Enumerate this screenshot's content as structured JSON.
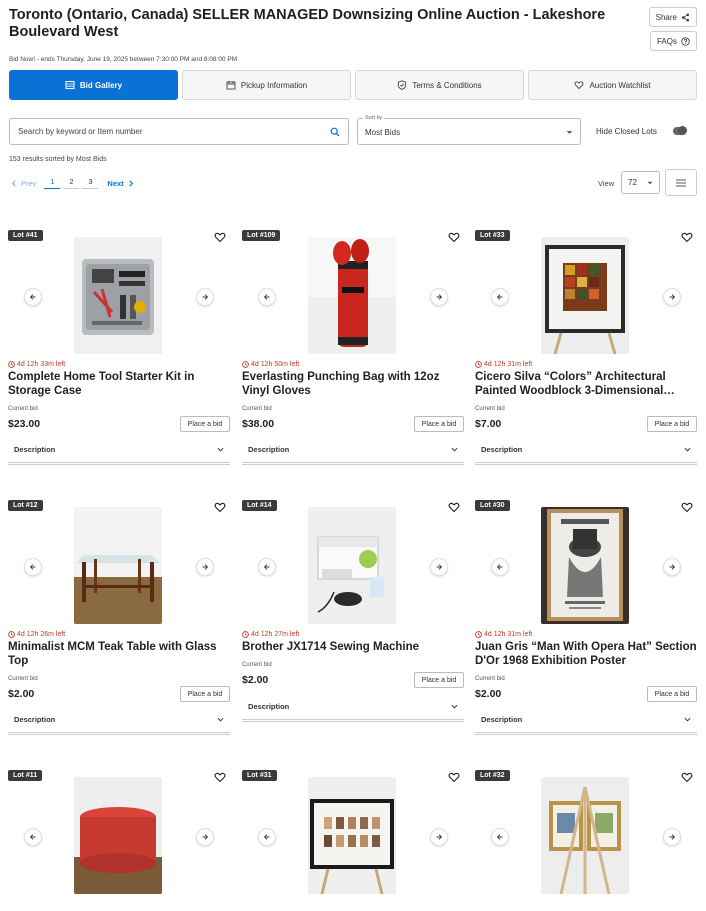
{
  "header": {
    "title": "Toronto (Ontario, Canada) SELLER MANAGED Downsizing Online Auction - Lakeshore Boulevard West",
    "share_label": "Share",
    "faqs_label": "FAQs",
    "subinfo": "Bid Now! - ends Thursday, June 19, 2025 between 7:30:00 PM and 8:08:00 PM"
  },
  "tabs": [
    {
      "label": "Bid Gallery",
      "icon": "gallery-icon",
      "active": true
    },
    {
      "label": "Pickup Information",
      "icon": "calendar-icon",
      "active": false
    },
    {
      "label": "Terms & Conditions",
      "icon": "shield-icon",
      "active": false
    },
    {
      "label": "Auction Watchlist",
      "icon": "heart-icon",
      "active": false
    }
  ],
  "search": {
    "placeholder": "Search by keyword or Item number"
  },
  "sort": {
    "label": "Sort by",
    "value": "Most Bids"
  },
  "hide_closed_label": "Hide Closed Lots",
  "results_text": "153 results sorted by Most Bids",
  "pagination": {
    "prev": "Prev",
    "pages": [
      "1",
      "2",
      "3"
    ],
    "current": "1",
    "next": "Next"
  },
  "view": {
    "label": "View",
    "value": "72"
  },
  "lots": [
    {
      "lot": "Lot #41",
      "time_left": "4d 12h 33m left",
      "title": "Complete Home Tool Starter Kit in Storage Case",
      "current_bid_label": "Current bid",
      "price": "$23.00",
      "bid_label": "Place a bid",
      "description_label": "Description"
    },
    {
      "lot": "Lot #109",
      "time_left": "4d 12h 50m left",
      "title": "Everlasting Punching Bag with 12oz Vinyl Gloves",
      "current_bid_label": "Current bid",
      "price": "$38.00",
      "bid_label": "Place a bid",
      "description_label": "Description"
    },
    {
      "lot": "Lot #33",
      "time_left": "4d 12h 31m left",
      "title": "Cicero Silva “Colors” Architectural Painted Woodblock 3-Dimensional…",
      "current_bid_label": "Current bid",
      "price": "$7.00",
      "bid_label": "Place a bid",
      "description_label": "Description"
    },
    {
      "lot": "Lot #12",
      "time_left": "4d 12h 26m left",
      "title": "Minimalist MCM Teak Table with Glass Top",
      "current_bid_label": "Current bid",
      "price": "$2.00",
      "bid_label": "Place a bid",
      "description_label": "Description"
    },
    {
      "lot": "Lot #14",
      "time_left": "4d 12h 27m left",
      "title": "Brother JX1714 Sewing Machine",
      "current_bid_label": "Current bid",
      "price": "$2.00",
      "bid_label": "Place a bid",
      "description_label": "Description"
    },
    {
      "lot": "Lot #30",
      "time_left": "4d 12h 31m left",
      "title": "Juan Gris “Man With Opera Hat” Section D'Or 1968 Exhibition Poster",
      "current_bid_label": "Current bid",
      "price": "$2.00",
      "bid_label": "Place a bid",
      "description_label": "Description"
    },
    {
      "lot": "Lot #11"
    },
    {
      "lot": "Lot #31"
    },
    {
      "lot": "Lot #32"
    }
  ],
  "colors": {
    "accent": "#0a72d4",
    "time_red": "#c0392b",
    "badge": "#3a3a3a"
  }
}
